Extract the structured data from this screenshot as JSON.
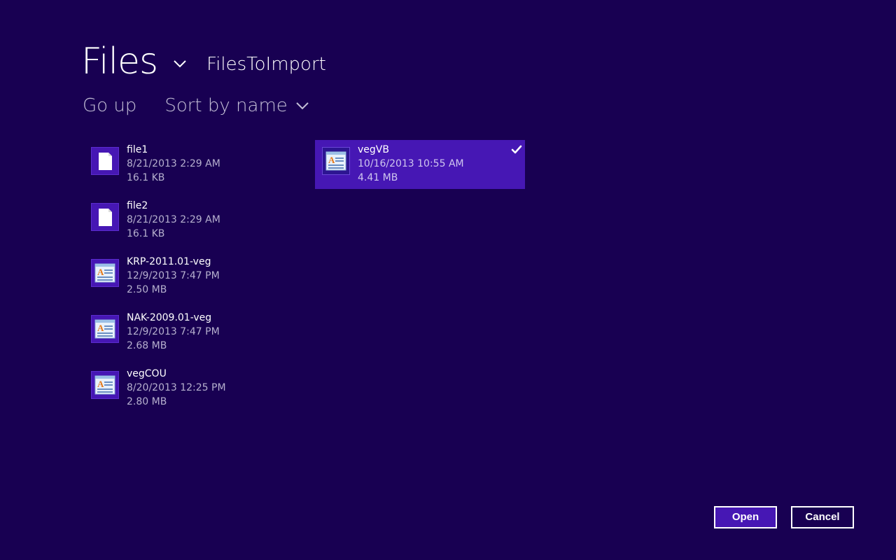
{
  "header": {
    "title": "Files",
    "folder": "FilesToImport"
  },
  "toolbar": {
    "go_up_label": "Go up",
    "sort_label": "Sort by name"
  },
  "files": [
    {
      "name": "file1",
      "date": "8/21/2013 2:29 AM",
      "size": "16.1 KB",
      "icon": "blank-document-icon",
      "selected": false
    },
    {
      "name": "file2",
      "date": "8/21/2013 2:29 AM",
      "size": "16.1 KB",
      "icon": "blank-document-icon",
      "selected": false
    },
    {
      "name": "KRP-2011.01-veg",
      "date": "12/9/2013 7:47 PM",
      "size": "2.50 MB",
      "icon": "text-document-icon",
      "selected": false
    },
    {
      "name": "NAK-2009.01-veg",
      "date": "12/9/2013 7:47 PM",
      "size": "2.68 MB",
      "icon": "text-document-icon",
      "selected": false
    },
    {
      "name": "vegCOU",
      "date": "8/20/2013 12:25 PM",
      "size": "2.80 MB",
      "icon": "text-document-icon",
      "selected": false
    },
    {
      "name": "vegVB",
      "date": "10/16/2013 10:55 AM",
      "size": "4.41 MB",
      "icon": "text-document-icon",
      "selected": true
    }
  ],
  "buttons": {
    "open_label": "Open",
    "cancel_label": "Cancel"
  },
  "colors": {
    "background": "#180052",
    "accent": "#4617b4"
  }
}
